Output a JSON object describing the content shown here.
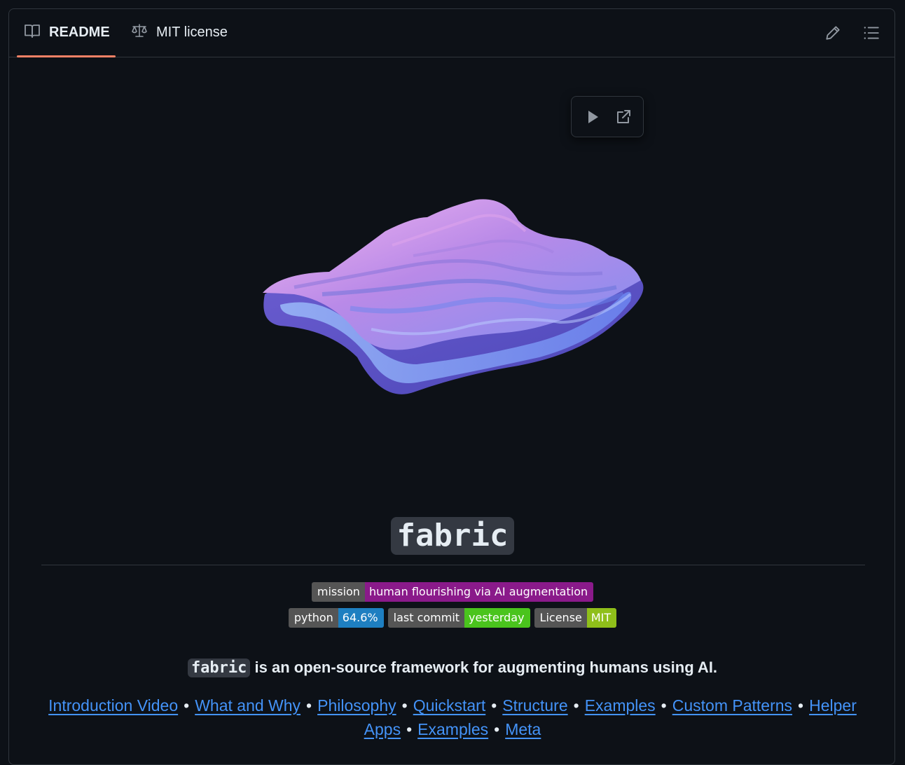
{
  "tabs": [
    {
      "label": "README",
      "icon": "book-icon",
      "active": true
    },
    {
      "label": "MIT license",
      "icon": "scale-icon",
      "active": false
    }
  ],
  "toolbar": {
    "edit_icon": "pencil-icon",
    "outline_icon": "list-icon"
  },
  "player": {
    "play_icon": "play-icon",
    "open_icon": "external-link-icon"
  },
  "hero": {
    "image": "fabric-logo-wave"
  },
  "title": "fabric",
  "badges": {
    "row1": [
      {
        "label": "mission",
        "value": "human flourishing via AI augmentation",
        "color": "#8a1a8a"
      }
    ],
    "row2": [
      {
        "label": "python",
        "value": "64.6%",
        "color": "#1e7fc1"
      },
      {
        "label": "last commit",
        "value": "yesterday",
        "color": "#4ac41d"
      },
      {
        "label": "License",
        "value": "MIT",
        "color": "#8fbf1a"
      }
    ]
  },
  "tagline": {
    "code": "fabric",
    "text": " is an open-source framework for augmenting humans using AI."
  },
  "links": [
    "Introduction Video",
    "What and Why",
    "Philosophy",
    "Quickstart",
    "Structure",
    "Examples",
    "Custom Patterns",
    "Helper Apps",
    "Examples",
    "Meta"
  ],
  "link_separator": "•"
}
